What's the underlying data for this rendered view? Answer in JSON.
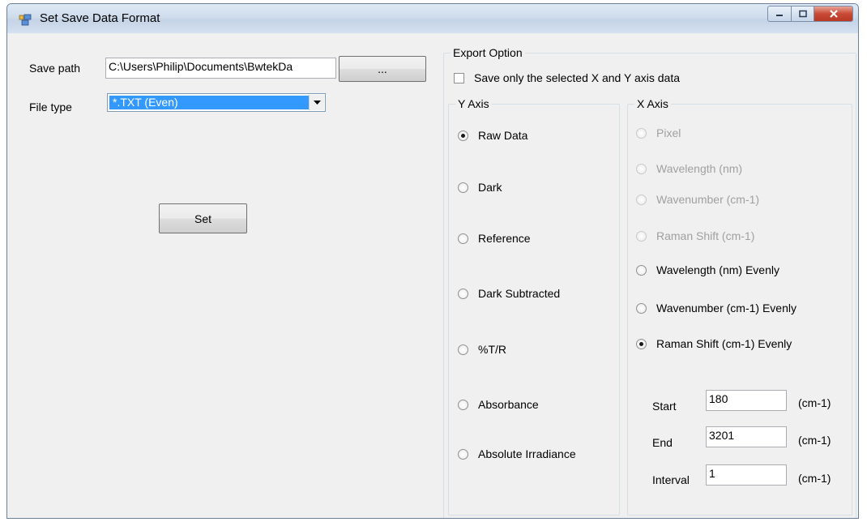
{
  "window": {
    "title": "Set Save Data Format"
  },
  "form": {
    "save_path_label": "Save path",
    "save_path_value": "C:\\Users\\Philip\\Documents\\BwtekDa",
    "browse_label": "...",
    "file_type_label": "File type",
    "file_type_value": "*.TXT (Even)",
    "set_label": "Set"
  },
  "export": {
    "group_label": "Export Option",
    "save_selected_label": "Save only the selected X and Y axis data",
    "save_selected_checked": false
  },
  "y_axis": {
    "label": "Y Axis",
    "options": [
      {
        "label": "Raw Data",
        "checked": true
      },
      {
        "label": "Dark",
        "checked": false
      },
      {
        "label": "Reference",
        "checked": false
      },
      {
        "label": "Dark Subtracted",
        "checked": false
      },
      {
        "label": "%T/R",
        "checked": false
      },
      {
        "label": "Absorbance",
        "checked": false
      },
      {
        "label": "Absolute Irradiance",
        "checked": false
      }
    ]
  },
  "x_axis": {
    "label": "X Axis",
    "options": [
      {
        "label": "Pixel",
        "enabled": false,
        "checked": false
      },
      {
        "label": "Wavelength  (nm)",
        "enabled": false,
        "checked": false
      },
      {
        "label": "Wavenumber  (cm-1)",
        "enabled": false,
        "checked": false
      },
      {
        "label": "Raman Shift (cm-1)",
        "enabled": false,
        "checked": false
      },
      {
        "label": "Wavelength  (nm)  Evenly",
        "enabled": true,
        "checked": false
      },
      {
        "label": "Wavenumber  (cm-1) Evenly",
        "enabled": true,
        "checked": false
      },
      {
        "label": "Raman Shift (cm-1) Evenly",
        "enabled": true,
        "checked": true
      }
    ],
    "start_label": "Start",
    "start_value": "180",
    "end_label": "End",
    "end_value": "3201",
    "interval_label": "Interval",
    "interval_value": "1",
    "unit": "(cm-1)"
  }
}
